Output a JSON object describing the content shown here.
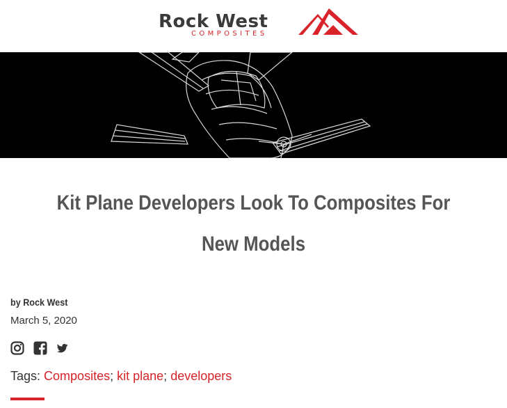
{
  "logo": {
    "word": "Rock West",
    "subword": "COMPOSITES",
    "brand_red": "#d8232a",
    "brand_dark": "#3a3a3a"
  },
  "hero": {
    "icon": "aircraft-wireframe-illustration",
    "background": "#000000"
  },
  "article": {
    "title": "Kit Plane Developers Look To Composites For New Models",
    "byline_prefix": "by",
    "author": "Rock West",
    "date": "March 5, 2020"
  },
  "social": [
    {
      "name": "instagram",
      "icon": "instagram-icon"
    },
    {
      "name": "facebook",
      "icon": "facebook-icon"
    },
    {
      "name": "twitter",
      "icon": "twitter-icon"
    }
  ],
  "tags": {
    "label": "Tags:",
    "items": [
      "Composites",
      "kit plane",
      "developers"
    ],
    "separator": ";"
  }
}
